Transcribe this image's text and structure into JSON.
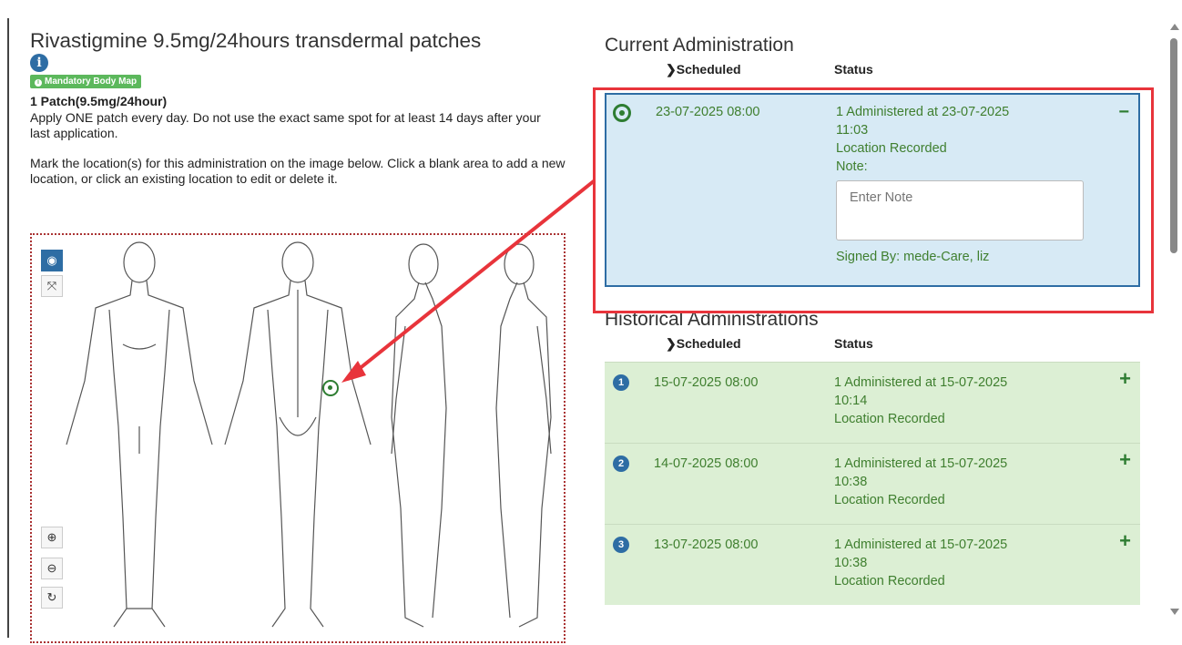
{
  "medication": {
    "title": "Rivastigmine 9.5mg/24hours transdermal patches",
    "info_icon": "info-icon",
    "badge": "Mandatory Body Map",
    "dose": "1 Patch(9.5mg/24hour)",
    "instruction": "Apply ONE patch every day. Do not use the exact same spot for at least 14 days after your last application.",
    "mark_instruction": "Mark the location(s) for this administration on the image below. Click a blank area to add a new location, or click an existing location to edit or delete it."
  },
  "body_map": {
    "tools": [
      "target-icon",
      "expand-icon",
      "zoom-in-icon",
      "zoom-out-icon",
      "refresh-icon"
    ]
  },
  "current": {
    "title": "Current Administration",
    "col_scheduled": "Scheduled",
    "col_status": "Status",
    "date": "23-07-2025 08:00",
    "status_line1": "1 Administered at 23-07-2025",
    "status_line2": "11:03",
    "status_line3": "Location Recorded",
    "note_label": "Note:",
    "note_placeholder": "Enter Note",
    "signed_by": "Signed By: mede-Care, liz",
    "toggle": "−"
  },
  "historical": {
    "title": "Historical Administrations",
    "col_scheduled": "Scheduled",
    "col_status": "Status",
    "rows": [
      {
        "num": "1",
        "date": "15-07-2025 08:00",
        "line1": "1 Administered at 15-07-2025",
        "line2": "10:14",
        "line3": "Location Recorded",
        "toggle": "+"
      },
      {
        "num": "2",
        "date": "14-07-2025 08:00",
        "line1": "1 Administered at 15-07-2025",
        "line2": "10:38",
        "line3": "Location Recorded",
        "toggle": "+"
      },
      {
        "num": "3",
        "date": "13-07-2025 08:00",
        "line1": "1 Administered at 15-07-2025",
        "line2": "10:38",
        "line3": "Location Recorded",
        "toggle": "+"
      }
    ]
  },
  "colors": {
    "accent": "#2e6da4",
    "status_green": "#3f7f2f",
    "callout_red": "#e8343b",
    "current_bg": "#d7eaf5",
    "hist_bg": "#dcefd4"
  }
}
